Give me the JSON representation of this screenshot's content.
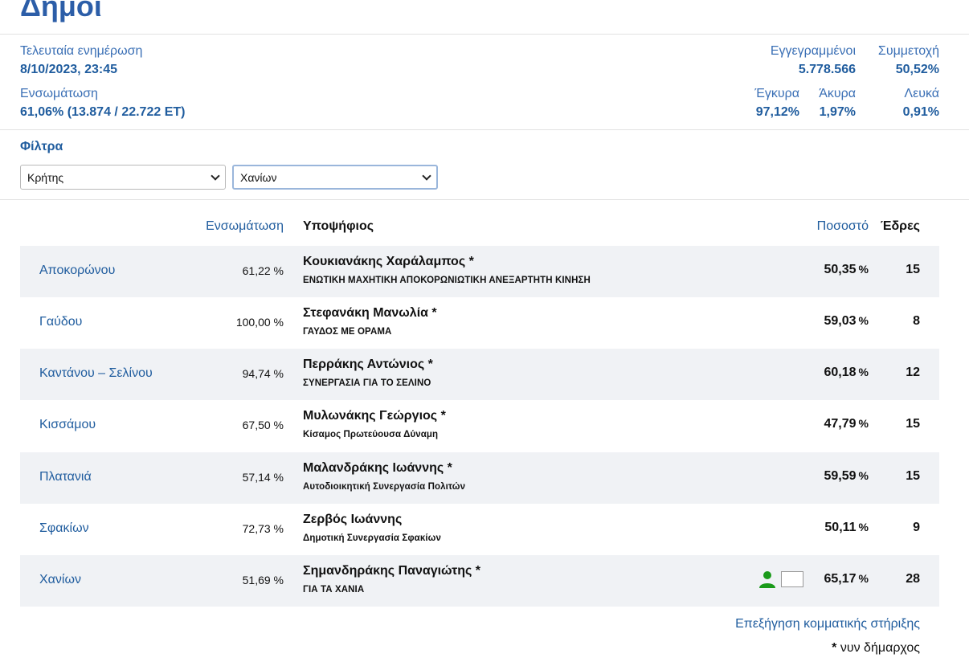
{
  "page": {
    "title": "Δήμοι"
  },
  "stats": {
    "last_update_label": "Τελευταία ενημέρωση",
    "last_update_value": "8/10/2023, 23:45",
    "integration_label": "Ενσωμάτωση",
    "integration_value": "61,06% (13.874 / 22.722 ΕΤ)",
    "registered_label": "Εγγεγραμμένοι",
    "registered_value": "5.778.566",
    "turnout_label": "Συμμετοχή",
    "turnout_value": "50,52%",
    "valid_label": "Έγκυρα",
    "valid_value": "97,12%",
    "invalid_label": "Άκυρα",
    "invalid_value": "1,97%",
    "blank_label": "Λευκά",
    "blank_value": "0,91%"
  },
  "filters": {
    "title": "Φίλτρα",
    "region_selected": "Κρήτης",
    "unit_selected": "Χανίων"
  },
  "table": {
    "headers": {
      "integration": "Ενσωμάτωση",
      "candidate": "Υποψήφιος",
      "percentage": "Ποσοστό",
      "seats": "Έδρες"
    },
    "percent_sign": "%",
    "rows": [
      {
        "municipality": "Αποκορώνου",
        "integration": "61,22 %",
        "candidate": "Κουκιανάκης Χαράλαμπος *",
        "party": "ΕΝΩΤΙΚΗ ΜΑΧΗΤΙΚΗ ΑΠΟΚΟΡΩΝΙΩΤΙΚΗ ΑΝΕΞΑΡΤΗΤΗ ΚΙΝΗΣΗ",
        "percentage": "50,35",
        "seats": "15"
      },
      {
        "municipality": "Γαύδου",
        "integration": "100,00 %",
        "candidate": "Στεφανάκη Μανωλία *",
        "party": "ΓΑΥΔΟΣ ΜΕ ΟΡΑΜΑ",
        "percentage": "59,03",
        "seats": "8"
      },
      {
        "municipality": "Καντάνου – Σελίνου",
        "integration": "94,74 %",
        "candidate": "Περράκης Αντώνιος *",
        "party": "ΣΥΝΕΡΓΑΣΙΑ ΓΙΑ ΤΟ ΣΕΛΙΝΟ",
        "percentage": "60,18",
        "seats": "12"
      },
      {
        "municipality": "Κισσάμου",
        "integration": "67,50 %",
        "candidate": "Μυλωνάκης Γεώργιος *",
        "party": "Κίσαμος Πρωτεύουσα Δύναμη",
        "percentage": "47,79",
        "seats": "15"
      },
      {
        "municipality": "Πλατανιά",
        "integration": "57,14 %",
        "candidate": "Μαλανδράκης Ιωάννης *",
        "party": "Αυτοδιοικητική Συνεργασία Πολιτών",
        "percentage": "59,59",
        "seats": "15"
      },
      {
        "municipality": "Σφακίων",
        "integration": "72,73 %",
        "candidate": "Ζερβός Ιωάννης",
        "party": "Δημοτική Συνεργασία Σφακίων",
        "percentage": "50,11",
        "seats": "9"
      },
      {
        "municipality": "Χανίων",
        "integration": "51,69 %",
        "candidate": "Σημανδηράκης Παναγιώτης *",
        "party": "ΓΙΑ ΤΑ ΧΑΝΙΑ",
        "percentage": "65,17",
        "seats": "28"
      }
    ]
  },
  "support_icons": {
    "person": "person-icon",
    "color": "#1a9a1a"
  },
  "footer": {
    "support_link": "Επεξήγηση κομματικής στήριξης",
    "note_star": "*",
    "note_text": " νυν δήμαρχος"
  }
}
